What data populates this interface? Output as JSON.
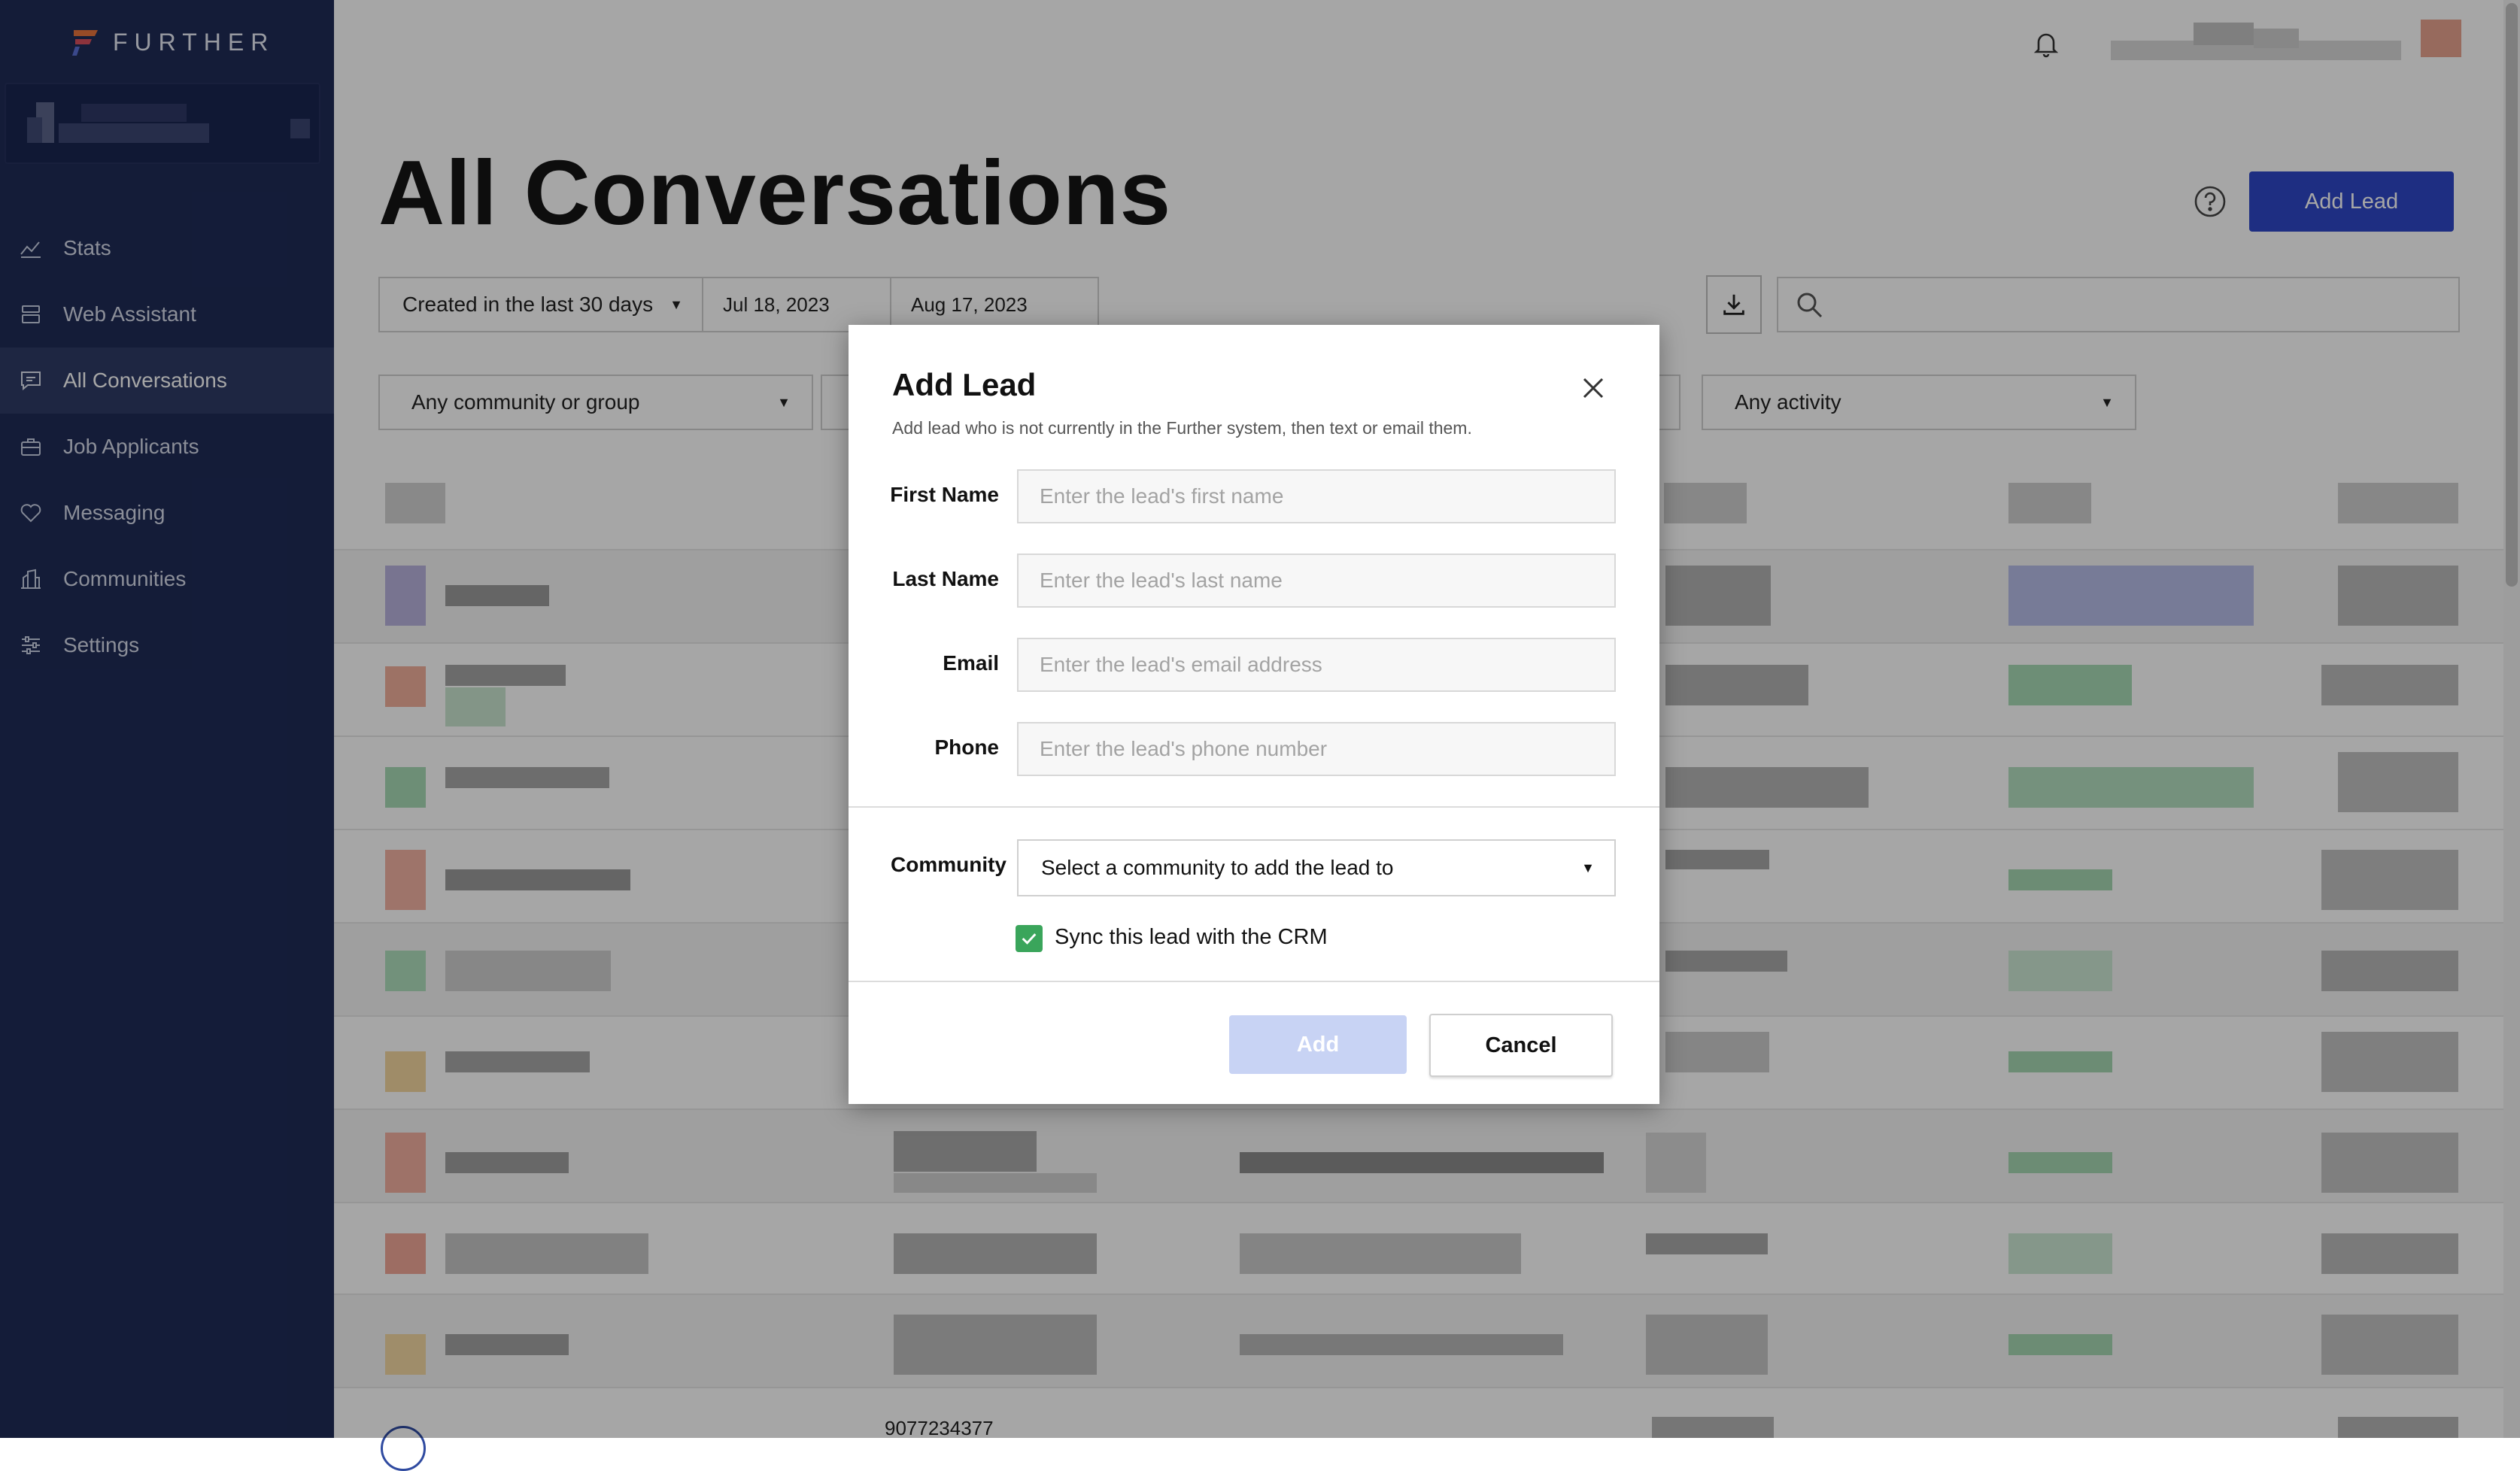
{
  "sidebar": {
    "brand": "FURTHER",
    "items": [
      {
        "label": "Stats",
        "icon": "stats-icon"
      },
      {
        "label": "Web Assistant",
        "icon": "web-assistant-icon"
      },
      {
        "label": "All Conversations",
        "icon": "conversations-icon",
        "active": true
      },
      {
        "label": "Job Applicants",
        "icon": "briefcase-icon"
      },
      {
        "label": "Messaging",
        "icon": "heart-icon"
      },
      {
        "label": "Communities",
        "icon": "building-icon"
      },
      {
        "label": "Settings",
        "icon": "sliders-icon"
      }
    ]
  },
  "header": {
    "title": "All Conversations",
    "add_lead_label": "Add Lead"
  },
  "filters": {
    "date_range": "Created in the last 30 days",
    "start_date": "Jul 18, 2023",
    "end_date": "Aug 17, 2023",
    "community": "Any community or group",
    "activity": "Any activity"
  },
  "table": {
    "partial_phone": "9077234377"
  },
  "modal": {
    "title": "Add Lead",
    "subtitle": "Add lead who is not currently in the Further system, then text or email them.",
    "fields": {
      "first_name": {
        "label": "First Name",
        "placeholder": "Enter the lead's first name"
      },
      "last_name": {
        "label": "Last Name",
        "placeholder": "Enter the lead's last name"
      },
      "email": {
        "label": "Email",
        "placeholder": "Enter the lead's email address"
      },
      "phone": {
        "label": "Phone",
        "placeholder": "Enter the lead's phone number"
      }
    },
    "community_label": "Community",
    "community_select": "Select a community to add the lead to",
    "sync_label": "Sync this lead with the CRM",
    "sync_checked": true,
    "add_button": "Add",
    "cancel_button": "Cancel"
  },
  "colors": {
    "sidebar_bg": "#1f2b57",
    "primary": "#2e48c8",
    "check": "#3aa55b",
    "disabled_button": "#c8d3f4"
  }
}
